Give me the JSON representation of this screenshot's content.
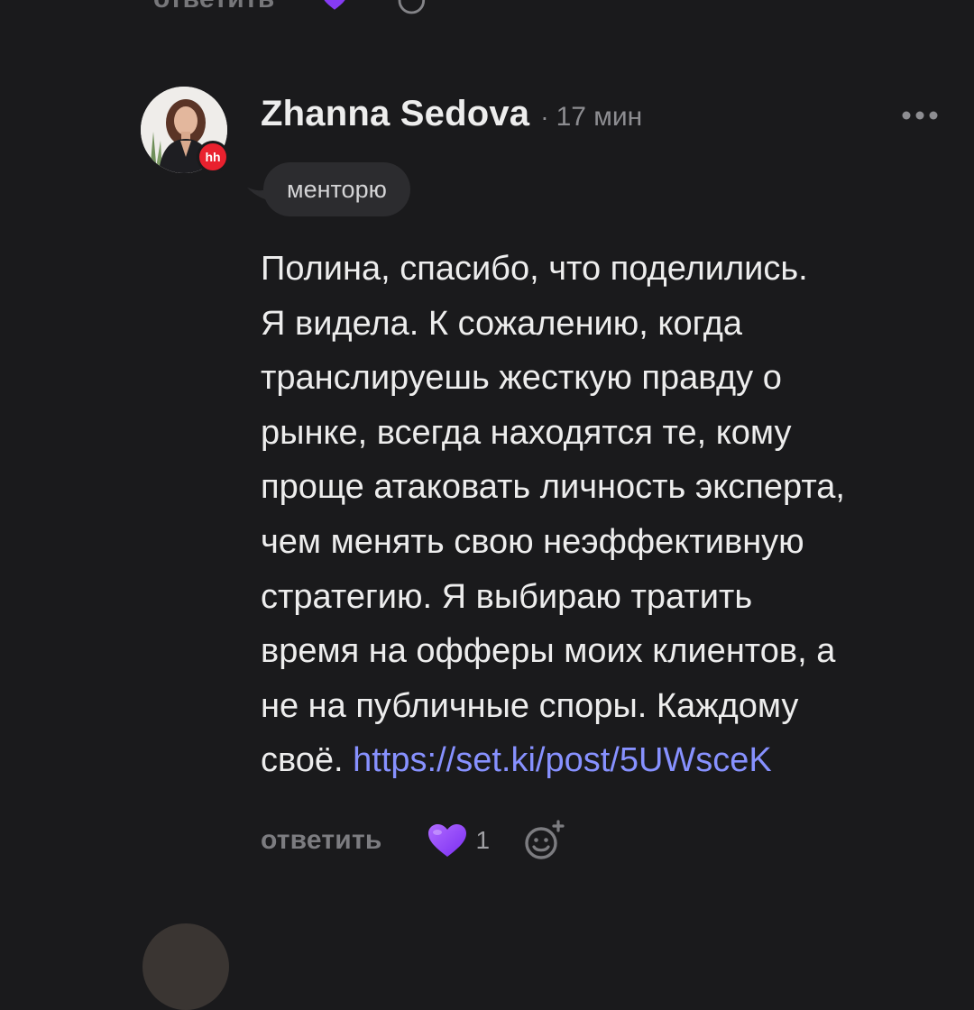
{
  "colors": {
    "background": "#1a1a1c",
    "text": "#ededed",
    "muted": "#8d8d91",
    "link": "#8791ff",
    "tag_bg": "#2c2c2f",
    "heart": "#8b3dff",
    "badge": "#e9212e"
  },
  "prev_comment": {
    "reply_label": "ответить",
    "icons": [
      "heart-icon",
      "add-reaction-icon"
    ]
  },
  "comment": {
    "author": "Zhanna Sedova",
    "separator": "·",
    "time": "17 мин",
    "badge": "hh",
    "tag": "менторю",
    "body_lines": [
      "Полина, спасибо, что поделились.",
      "Я видела. К сожалению, когда",
      "транслируешь жесткую правду о",
      "рынке, всегда находятся те, кому",
      "проще атаковать личность эксперта,",
      "чем менять свою неэффективную",
      "стратегию. Я выбираю тратить",
      "время на офферы моих клиентов, а",
      "не на публичные споры. Каждому"
    ],
    "last_line_text": "своё. ",
    "link": "https://set.ki/post/5UWsceK",
    "actions": {
      "reply_label": "ответить",
      "like_count": "1",
      "icons": [
        "heart-icon",
        "add-reaction-icon",
        "more-icon"
      ]
    }
  }
}
